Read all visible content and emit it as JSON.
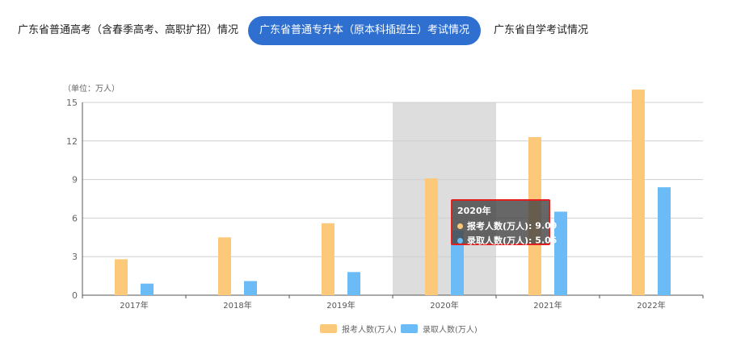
{
  "tabs": [
    {
      "label": "广东省普通高考（含春季高考、高职扩招）情况",
      "active": false
    },
    {
      "label": "广东省普通专升本（原本科插班生）考试情况",
      "active": true
    },
    {
      "label": "广东省自学考试情况",
      "active": false
    }
  ],
  "colors": {
    "accent": "#2f6fcf",
    "series1": "#fcc97a",
    "series2": "#6bbcf6",
    "highlight": "#dddddd",
    "tooltip_border": "#e02020"
  },
  "chart_data": {
    "type": "bar",
    "unit_label": "（单位：万人）",
    "categories": [
      "2017年",
      "2018年",
      "2019年",
      "2020年",
      "2021年",
      "2022年"
    ],
    "series": [
      {
        "name": "报考人数(万人)",
        "values": [
          2.8,
          4.5,
          5.6,
          9.09,
          12.3,
          16.0
        ]
      },
      {
        "name": "录取人数(万人)",
        "values": [
          0.9,
          1.1,
          1.8,
          5.05,
          6.5,
          8.4
        ]
      }
    ],
    "ylim": [
      0,
      15
    ],
    "yticks": [
      0,
      3,
      6,
      9,
      12,
      15
    ],
    "grid": true,
    "legend_position": "bottom-center",
    "highlighted_category": "2020年"
  },
  "tooltip": {
    "title": "2020年",
    "rows": [
      {
        "label": "报考人数(万人): ",
        "value": "9.09"
      },
      {
        "label": "录取人数(万人): ",
        "value": "5.05"
      }
    ]
  }
}
